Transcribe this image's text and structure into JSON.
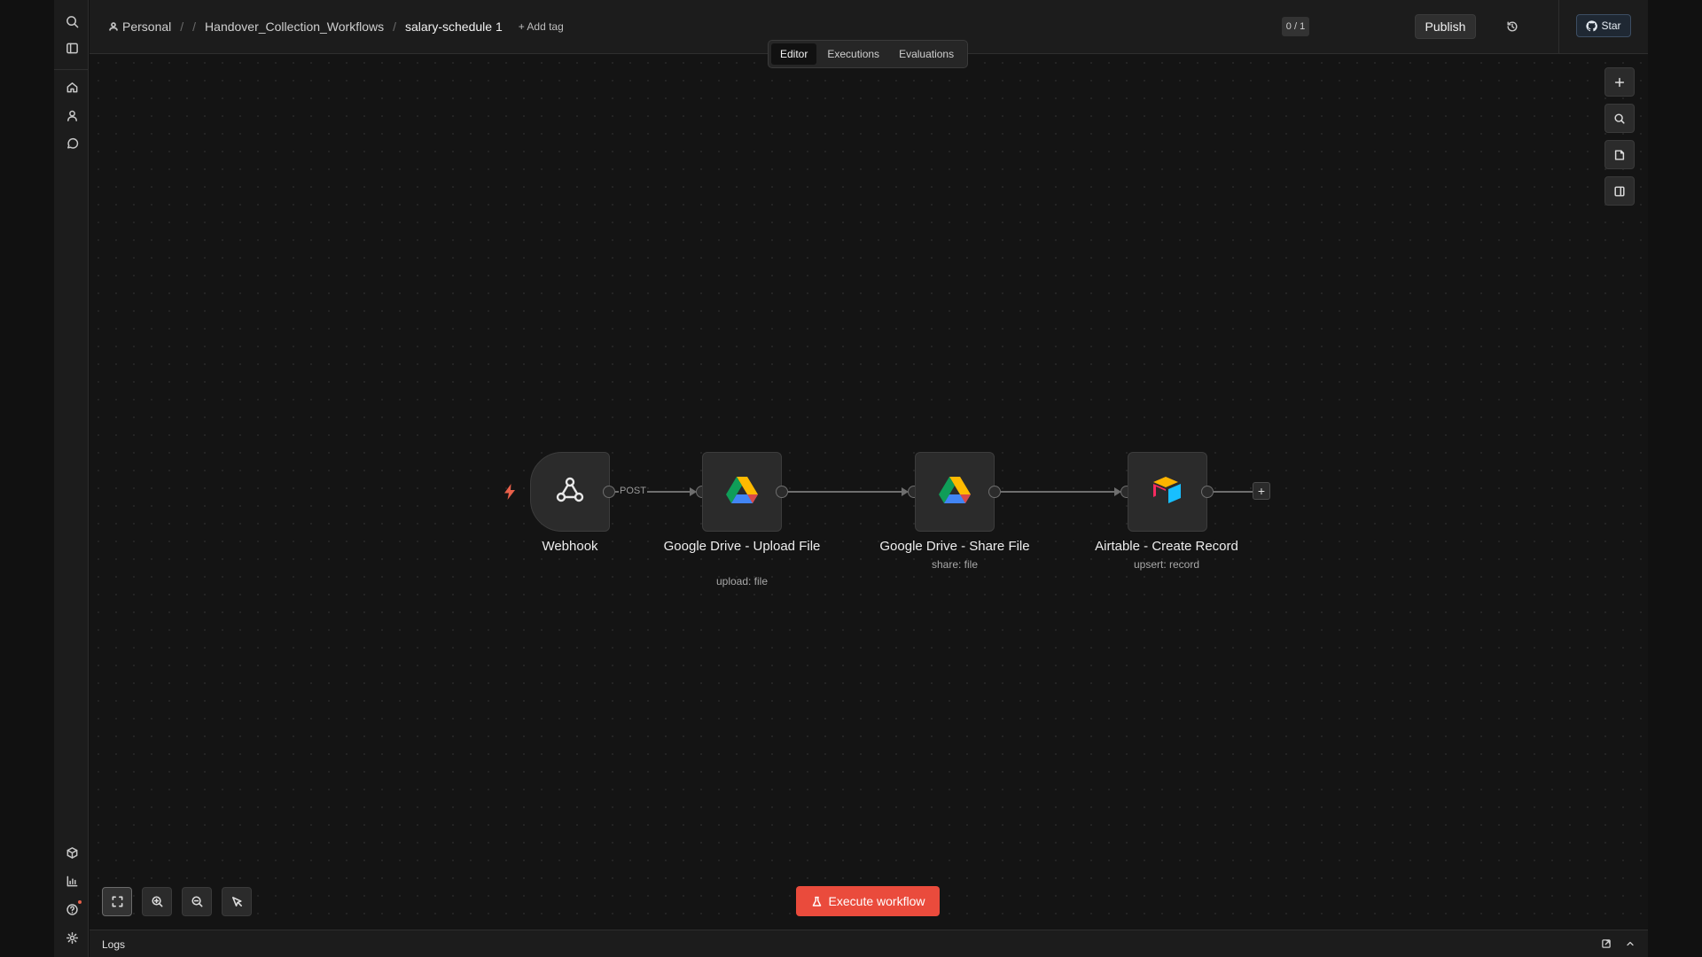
{
  "header": {
    "breadcrumbs": {
      "owner": "Personal",
      "folder": "Handover_Collection_Workflows",
      "workflow": "salary-schedule 1"
    },
    "add_tag": "+ Add tag",
    "counter": "0 / 1",
    "publish_label": "Publish",
    "star_label": "Star"
  },
  "tabs": [
    "Editor",
    "Executions",
    "Evaluations"
  ],
  "nodes": [
    {
      "title": "Webhook",
      "subtitle": "",
      "icon": "webhook-icon"
    },
    {
      "title": "Google Drive - Upload File",
      "subtitle": "upload: file",
      "icon": "google-drive-icon"
    },
    {
      "title": "Google Drive - Share File",
      "subtitle": "share: file",
      "icon": "google-drive-icon"
    },
    {
      "title": "Airtable - Create Record",
      "subtitle": "upsert: record",
      "icon": "airtable-icon"
    }
  ],
  "edge_label": "POST",
  "execute_label": "Execute workflow",
  "logs_label": "Logs",
  "colors": {
    "accent": "#ea4b3c",
    "canvas": "#141414",
    "node": "#2b2b2b"
  }
}
